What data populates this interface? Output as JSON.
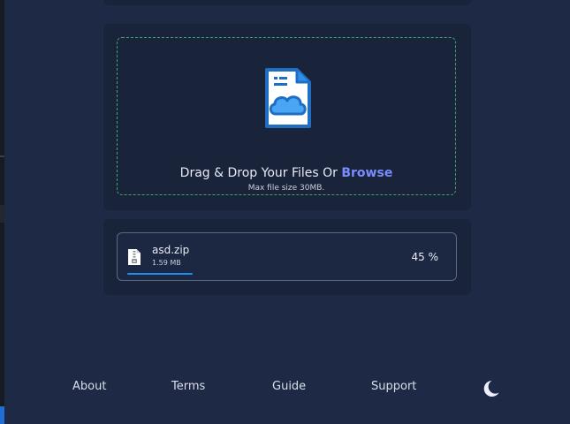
{
  "upload": {
    "drop_text": "Drag & Drop Your Files Or ",
    "browse_label": "Browse",
    "hint": "Max file size 30MB.",
    "illustration_icon": "file-cloud-icon"
  },
  "files": [
    {
      "name": "asd.zip",
      "size": "1.59 MB",
      "percent_text": "45 %",
      "progress": 0.45,
      "icon": "zip-file-icon"
    }
  ],
  "footer": {
    "links": [
      "About",
      "Terms",
      "Guide",
      "Support"
    ],
    "theme_toggle_icon": "moon-icon"
  },
  "colors": {
    "background": "#1e2a45",
    "card": "#19233a",
    "accent": "#7b8cff",
    "progress": "#1e8ff0",
    "dropzone_border": "#3fa46a"
  }
}
